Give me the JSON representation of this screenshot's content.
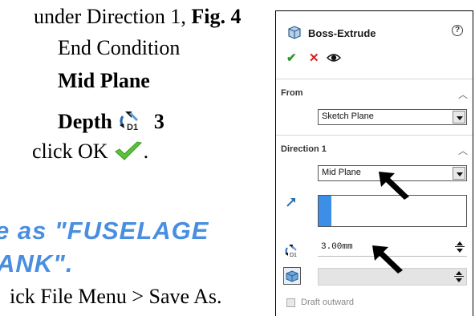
{
  "tutorial": {
    "line1_prefix": "under Direction 1, ",
    "line1_fig": "Fig. 4",
    "end_condition_label": "End Condition",
    "end_condition_value": "Mid Plane",
    "depth_label": "Depth",
    "depth_value": "3",
    "click_ok": "click OK",
    "period": ".",
    "heading_line1": "e as \"FUSELAGE",
    "heading_line2": "ANK\".",
    "save_instruction": "ick File Menu > Save As."
  },
  "property_manager": {
    "title": "Boss-Extrude",
    "help_symbol": "?",
    "actions": {
      "ok": "✔",
      "cancel": "✕"
    },
    "sections": {
      "from": {
        "label": "From",
        "value": "Sketch Plane"
      },
      "direction1": {
        "label": "Direction 1",
        "end_condition": "Mid Plane",
        "depth": "3.00mm"
      }
    },
    "draft_label": "Draft outward"
  },
  "colors": {
    "accent_blue": "#3d8ee6",
    "heading_blue": "#4a8ee0",
    "ok_green": "#2a9a2a",
    "cancel_red": "#d62020"
  },
  "icons": {
    "feature": "boss-extrude-icon",
    "help": "help-icon",
    "preview": "eye-icon",
    "direction": "reverse-direction-arrow-icon",
    "depth": "depth-dimension-icon",
    "face": "face-selection-icon",
    "pointer": "black-arrow-pointer-icon"
  }
}
